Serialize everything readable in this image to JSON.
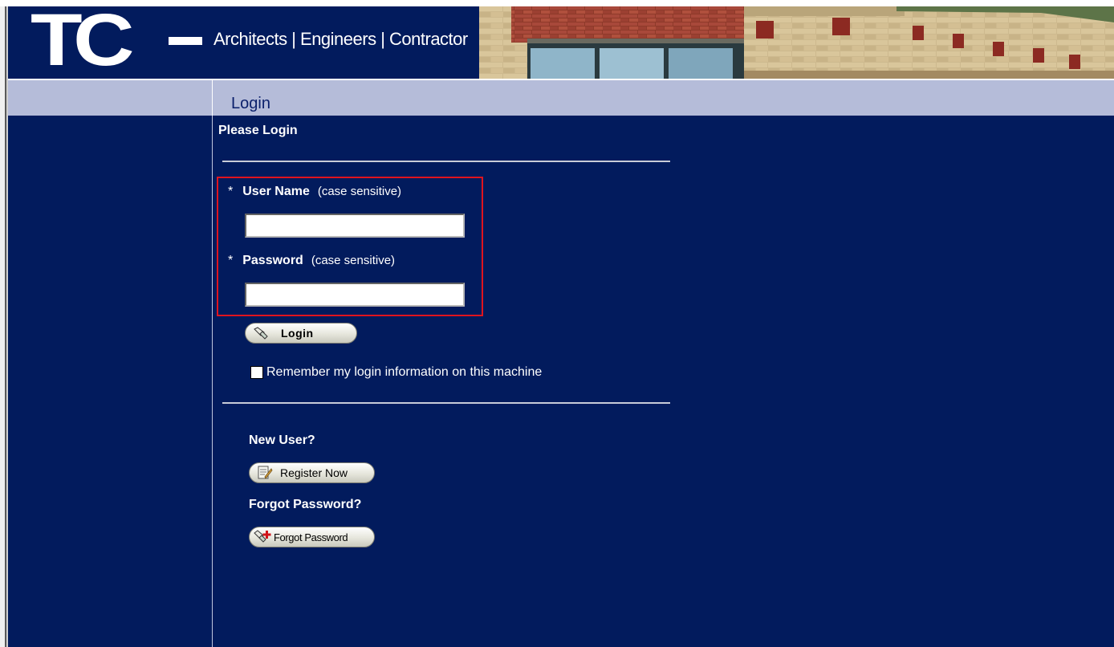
{
  "header": {
    "logo_text": "TC",
    "tagline": "Architects | Engineers | Contractor"
  },
  "nav": {
    "page_title": "Login"
  },
  "form": {
    "heading": "Please Login",
    "required_marker": "*",
    "username_label": "User Name",
    "username_hint": "(case sensitive)",
    "username_value": "",
    "password_label": "Password",
    "password_hint": "(case sensitive)",
    "password_value": "",
    "login_button": "Login",
    "remember_label": "Remember my login information on this machine",
    "remember_checked": false
  },
  "new_user": {
    "heading": "New User?",
    "register_button": "Register Now"
  },
  "forgot": {
    "heading": "Forgot Password?",
    "forgot_button": "Forgot Password"
  },
  "colors": {
    "background": "#021b5d",
    "nav_bar": "#b5bcd9",
    "highlight_box": "#e0141e"
  }
}
